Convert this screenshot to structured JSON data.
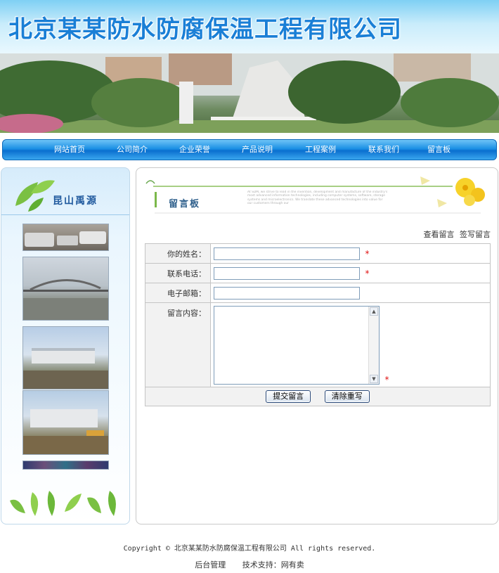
{
  "header": {
    "site_title": "北京某某防水防腐保温工程有限公司"
  },
  "nav": {
    "items": [
      {
        "label": "网站首页"
      },
      {
        "label": "公司简介"
      },
      {
        "label": "企业荣誉"
      },
      {
        "label": "产品说明"
      },
      {
        "label": "工程案例"
      },
      {
        "label": "联系我们"
      },
      {
        "label": "留言板"
      }
    ]
  },
  "sidebar": {
    "title": "昆山禹源"
  },
  "main": {
    "board_title": "留言板",
    "header_small_text": "At SDM, we strive to lead in the invention, development and manufacture of the industry's most advanced information technologies, including computer systems, software, storage systems and microelectronics. We translate these advanced technologies into value for our customers through our",
    "links": {
      "view": "查看留言",
      "write": "签写留言"
    },
    "form": {
      "name_label": "你的姓名：",
      "phone_label": "联系电话：",
      "email_label": "电子邮箱：",
      "content_label": "留言内容：",
      "required_mark": "*",
      "name_value": "",
      "phone_value": "",
      "email_value": "",
      "content_value": "",
      "submit_label": "提交留言",
      "reset_label": "清除重写"
    }
  },
  "footer": {
    "copyright": "Copyright © 北京某某防水防腐保温工程有限公司 All rights reserved.",
    "admin_link": "后台管理",
    "support": "技术支持：网有卖"
  },
  "colors": {
    "nav_blue": "#1a8fe4",
    "title_blue": "#1a7fd6",
    "required_red": "#e01010"
  }
}
